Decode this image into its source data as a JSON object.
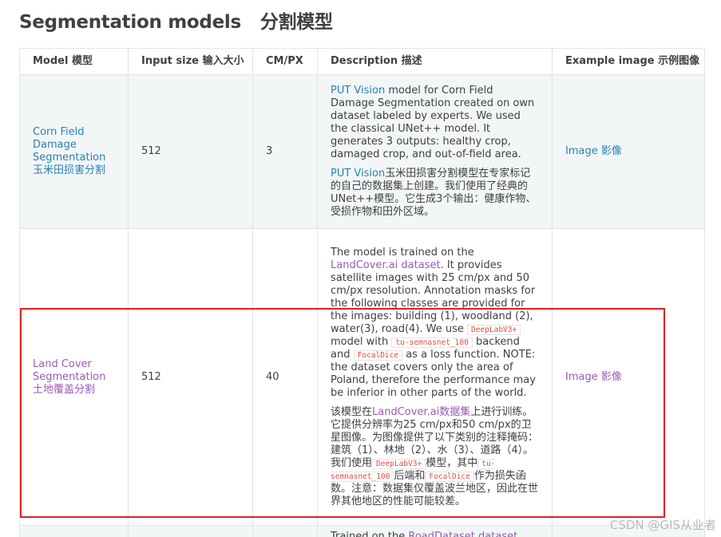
{
  "page": {
    "title": "Segmentation models",
    "title_zh": "分割模型"
  },
  "table": {
    "headers": {
      "model": "Model 模型",
      "input_size": "Input size 输入大小",
      "cm_px": "CM/PX",
      "description": "Description 描述",
      "example": "Example image 示例图像"
    },
    "rows": [
      {
        "model_name": "Corn Field Damage Segmentation 玉米田损害分割",
        "input_size": "512",
        "cm_px": "3",
        "desc_en_link": "PUT Vision",
        "desc_en_text": " model for Corn Field Damage Segmentation created on own dataset labeled by experts. We used the classical UNet++ model. It generates 3 outputs: healthy crop, damaged crop, and out-of-field area.",
        "desc_zh_link": "PUT Vision",
        "desc_zh_text": "玉米田损害分割模型在专家标记的自己的数据集上创建。我们使用了经典的UNet++模型。它生成3个输出：健康作物、受损作物和田外区域。",
        "example_link": "Image 影像"
      },
      {
        "model_name": "Land Cover Segmentation 土地覆盖分割",
        "input_size": "512",
        "cm_px": "40",
        "desc_en_a": "The model is trained on the ",
        "desc_en_link": "LandCover.ai dataset",
        "desc_en_b": ". It provides satellite images with 25 cm/px and 50 cm/px resolution. Annotation masks for the following classes are provided for the images: building (1), woodland (2), water(3), road(4). We use ",
        "desc_en_code1": "DeepLabV3+",
        "desc_en_c": " model with ",
        "desc_en_code2": "tu-semnasnet_100",
        "desc_en_d": " backend and ",
        "desc_en_code3": "FocalDice",
        "desc_en_e": " as a loss function. NOTE: the dataset covers only the area of Poland, therefore the performance may be inferior in other parts of the world.",
        "desc_zh_a": "该模型在",
        "desc_zh_link": "LandCover.ai数据集",
        "desc_zh_b": "上进行训练。它提供分辨率为25 cm/px和50 cm/px的卫星图像。为图像提供了以下类别的注释掩码：建筑（1）、林地（2）、水（3）、道路（4）。我们使用",
        "desc_zh_code1": "DeepLabV3+",
        "desc_zh_c": "模型，其中",
        "desc_zh_code2": "tu-semnasnet_100",
        "desc_zh_d": "后端和",
        "desc_zh_code3": "FocalDice",
        "desc_zh_e": "作为损失函数。注意：数据集仅覆盖波兰地区，因此在世界其他地区的性能可能较差。",
        "example_link": "Image 影像"
      },
      {
        "desc_en_a": "Trained on the ",
        "desc_en_link": "RoadDataset dataset"
      }
    ]
  },
  "watermark": "CSDN @GIS从业者",
  "colors": {
    "link": "#2980b9",
    "visited_link": "#9b59b6",
    "code": "#e74c3c",
    "highlight": "#e02020",
    "row_stripe": "#f3f6f6",
    "border": "#e1e4e5"
  }
}
